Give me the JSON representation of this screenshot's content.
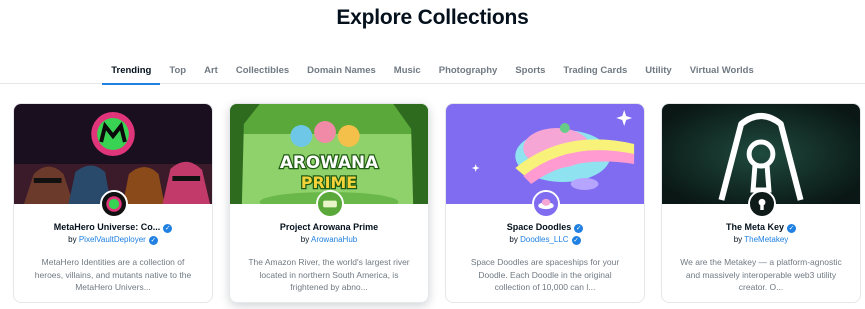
{
  "page": {
    "title": "Explore Collections"
  },
  "tabs": [
    {
      "label": "Trending",
      "active": true
    },
    {
      "label": "Top"
    },
    {
      "label": "Art"
    },
    {
      "label": "Collectibles"
    },
    {
      "label": "Domain Names"
    },
    {
      "label": "Music"
    },
    {
      "label": "Photography"
    },
    {
      "label": "Sports"
    },
    {
      "label": "Trading Cards"
    },
    {
      "label": "Utility"
    },
    {
      "label": "Virtual Worlds"
    }
  ],
  "collections": [
    {
      "title": "MetaHero Universe: Co...",
      "by_prefix": "by",
      "creator": "PixelVaultDeployer",
      "creator_verified": true,
      "title_verified": true,
      "description": "MetaHero Identities are a collection of heroes, villains, and mutants native to the MetaHero Univers...",
      "banner_icon": "metahero-logo-banner",
      "avatar_icon": "metahero-avatar"
    },
    {
      "title": "Project Arowana Prime",
      "by_prefix": "by",
      "creator": "ArowanaHub",
      "creator_verified": false,
      "title_verified": false,
      "description": "The Amazon River, the world's largest river located in northern South America, is frightened by abno...",
      "banner_text": "AROWANA",
      "banner_subtext": "PRIME",
      "avatar_icon": "arowana-avatar"
    },
    {
      "title": "Space Doodles",
      "by_prefix": "by",
      "creator": "Doodles_LLC",
      "creator_verified": true,
      "title_verified": true,
      "description": "Space Doodles are spaceships for your Doodle. Each Doodle in the original collection of 10,000 can l...",
      "banner_icon": "space-doodles-banner",
      "avatar_icon": "spaceship-avatar"
    },
    {
      "title": "The Meta Key",
      "by_prefix": "by",
      "creator": "TheMetakey",
      "creator_verified": false,
      "title_verified": true,
      "description": "We are the Metakey — a platform-agnostic and massively interoperable web3 utility creator. O...",
      "banner_icon": "keyhole-neon-banner",
      "avatar_icon": "keyhole-avatar"
    }
  ],
  "colors": {
    "accent": "#2081e2",
    "text": "#04111d",
    "muted": "#707a83"
  }
}
